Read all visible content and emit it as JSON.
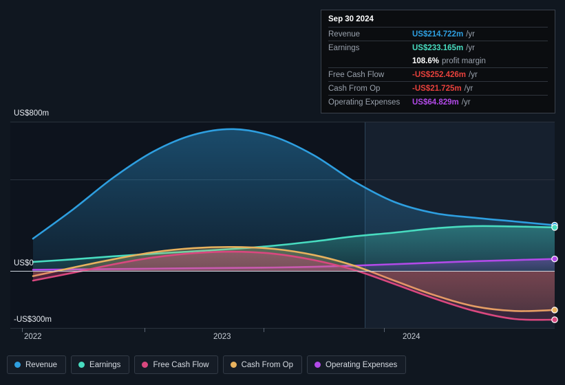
{
  "chart_data": {
    "type": "area",
    "title": "",
    "xlabel": "",
    "ylabel": "",
    "ylim": [
      -300,
      800
    ],
    "y_ticks": [
      "US$800m",
      "US$0",
      "-US$300m"
    ],
    "y_tick_values": [
      800,
      0,
      -300
    ],
    "x_ticks": [
      "2022",
      "2023",
      "2024"
    ],
    "grid": true,
    "legend_position": "bottom",
    "forecast_boundary_label": "",
    "units": "US$ millions per year",
    "x": [
      2021.75,
      2022.0,
      2022.25,
      2022.5,
      2022.75,
      2023.0,
      2023.25,
      2023.5,
      2023.75,
      2024.0,
      2024.25,
      2024.5,
      2024.75
    ],
    "series": [
      {
        "name": "Revenue",
        "color": "#2e9fe0",
        "values": [
          173,
          330,
          500,
          640,
          730,
          760,
          720,
          620,
          480,
          370,
          310,
          285,
          265,
          245
        ]
      },
      {
        "name": "Earnings",
        "color": "#48dcc0",
        "values": [
          48,
          62,
          78,
          92,
          105,
          118,
          135,
          158,
          185,
          205,
          228,
          240,
          238,
          233
        ]
      },
      {
        "name": "Free Cash Flow",
        "color": "#d9487f",
        "values": [
          -52,
          -10,
          35,
          72,
          95,
          103,
          92,
          58,
          5,
          -70,
          -148,
          -215,
          -258,
          -262
        ]
      },
      {
        "name": "Cash From Op",
        "color": "#e8b25e",
        "values": [
          -28,
          18,
          62,
          100,
          122,
          128,
          118,
          85,
          28,
          -52,
          -130,
          -190,
          -215,
          -210
        ]
      },
      {
        "name": "Operating Expenses",
        "color": "#b24ae8",
        "values": [
          6,
          8,
          10,
          12,
          14,
          16,
          18,
          22,
          28,
          36,
          44,
          52,
          58,
          64
        ]
      }
    ]
  },
  "tooltip": {
    "date": "Sep 30 2024",
    "rows": [
      {
        "label": "Revenue",
        "value": "US$214.722m",
        "unit": "/yr",
        "color": "#2e9fe0"
      },
      {
        "label": "Earnings",
        "value": "US$233.165m",
        "unit": "/yr",
        "color": "#48dcc0"
      },
      {
        "label": "",
        "value": "108.6%",
        "unit": "profit margin",
        "color": "#ffffff"
      },
      {
        "label": "Free Cash Flow",
        "value": "-US$252.426m",
        "unit": "/yr",
        "color": "#e8413c"
      },
      {
        "label": "Cash From Op",
        "value": "-US$21.725m",
        "unit": "/yr",
        "color": "#e8413c"
      },
      {
        "label": "Operating Expenses",
        "value": "US$64.829m",
        "unit": "/yr",
        "color": "#b24ae8"
      }
    ]
  },
  "axis": {
    "y_top": "US$800m",
    "y_zero": "US$0",
    "y_bottom": "-US$300m",
    "x1": "2022",
    "x2": "2023",
    "x3": "2024"
  },
  "legend": {
    "items": [
      {
        "label": "Revenue",
        "color": "#2e9fe0"
      },
      {
        "label": "Earnings",
        "color": "#48dcc0"
      },
      {
        "label": "Free Cash Flow",
        "color": "#d9487f"
      },
      {
        "label": "Cash From Op",
        "color": "#e8b25e"
      },
      {
        "label": "Operating Expenses",
        "color": "#b24ae8"
      }
    ]
  }
}
